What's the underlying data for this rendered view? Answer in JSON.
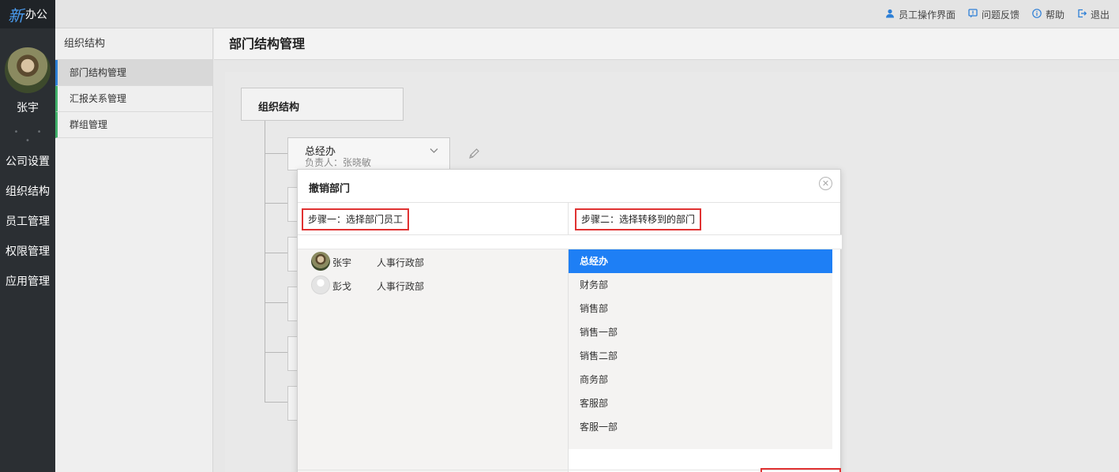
{
  "brand": {
    "logo_mark": "新",
    "logo_text": "办公"
  },
  "user": {
    "name": "张宇"
  },
  "nav": {
    "dots": "• • •",
    "items": [
      "公司设置",
      "组织结构",
      "员工管理",
      "权限管理",
      "应用管理"
    ]
  },
  "topbar": {
    "links": [
      {
        "label": "员工操作界面",
        "icon": "user-icon"
      },
      {
        "label": "问题反馈",
        "icon": "feedback-icon"
      },
      {
        "label": "帮助",
        "icon": "info-icon"
      },
      {
        "label": "退出",
        "icon": "logout-icon"
      }
    ]
  },
  "subside": {
    "title": "组织结构",
    "items": [
      "部门结构管理",
      "汇报关系管理",
      "群组管理"
    ],
    "active_index": 0
  },
  "main": {
    "title": "部门结构管理",
    "org_root": "组织结构",
    "dept_card": {
      "name": "总经办",
      "lead": "负责人：张晓敏"
    }
  },
  "modal": {
    "title": "撤销部门",
    "close_symbol": "✕",
    "step1": "步骤一：选择部门员工",
    "step2": "步骤二：选择转移到的部门",
    "employees": [
      {
        "name": "张宇",
        "dept": "人事行政部",
        "avatar": "photo"
      },
      {
        "name": "彭戈",
        "dept": "人事行政部",
        "avatar": "blank"
      }
    ],
    "departments": [
      "总经办",
      "财务部",
      "销售部",
      "销售一部",
      "销售二部",
      "商务部",
      "客服部",
      "客服一部"
    ],
    "selected_department": "总经办"
  },
  "colors": {
    "nav_bg": "#2b2f33",
    "accent": "#1e7ff5",
    "highlight_border": "#e03232",
    "sub_active_border": "#2d7fd6",
    "sub_border": "#40b06a"
  }
}
